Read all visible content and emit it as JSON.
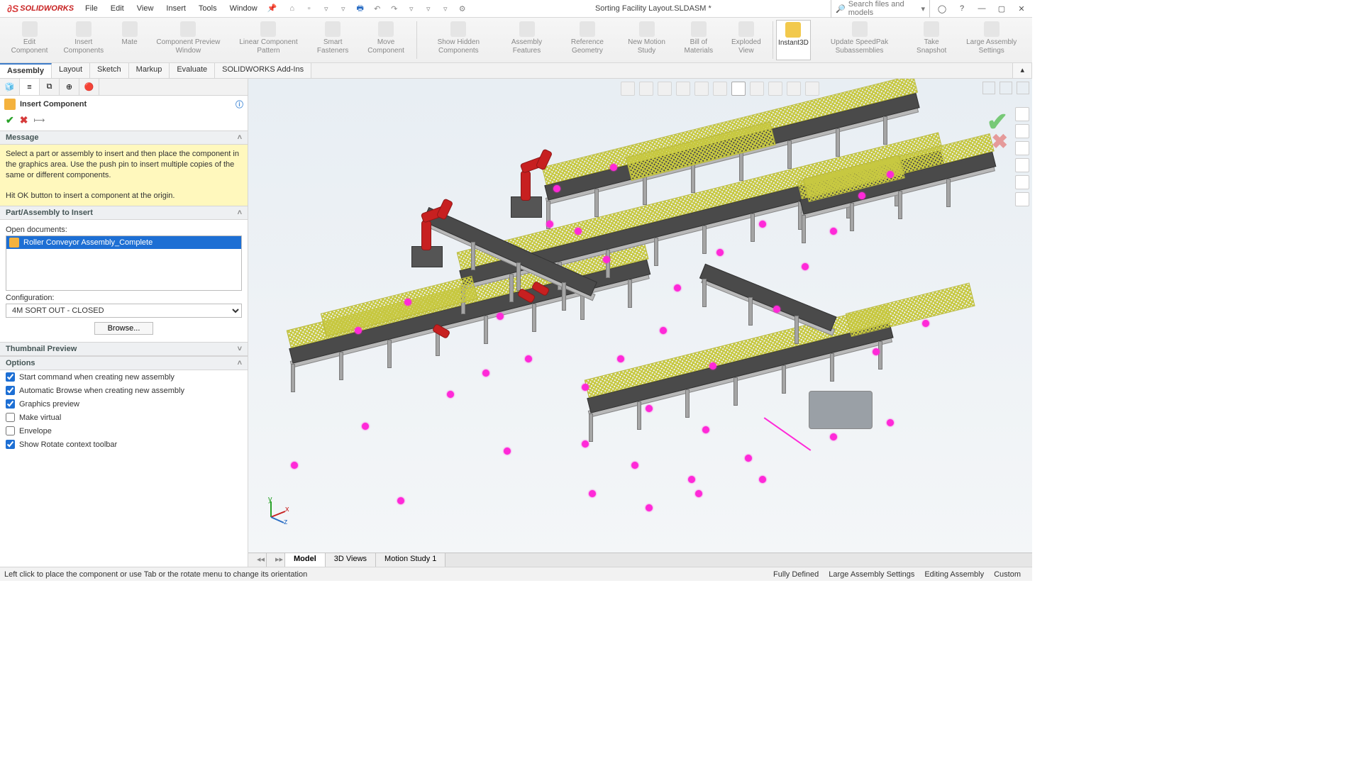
{
  "app": {
    "brand": "SOLIDWORKS",
    "doc_title": "Sorting Facility Layout.SLDASM *",
    "search_placeholder": "Search files and models"
  },
  "menu": {
    "items": [
      "File",
      "Edit",
      "View",
      "Insert",
      "Tools",
      "Window"
    ]
  },
  "ribbon": {
    "buttons": [
      {
        "label": "Edit Component"
      },
      {
        "label": "Insert Components"
      },
      {
        "label": "Mate"
      },
      {
        "label": "Component Preview Window"
      },
      {
        "label": "Linear Component Pattern"
      },
      {
        "label": "Smart Fasteners"
      },
      {
        "label": "Move Component"
      },
      {
        "label": "Show Hidden Components",
        "sep": true
      },
      {
        "label": "Assembly Features"
      },
      {
        "label": "Reference Geometry"
      },
      {
        "label": "New Motion Study"
      },
      {
        "label": "Bill of Materials"
      },
      {
        "label": "Exploded View"
      },
      {
        "label": "Instant3D",
        "active": true,
        "sep": true
      },
      {
        "label": "Update SpeedPak Subassemblies"
      },
      {
        "label": "Take Snapshot"
      },
      {
        "label": "Large Assembly Settings"
      }
    ]
  },
  "ribbon_tabs": [
    "Assembly",
    "Layout",
    "Sketch",
    "Markup",
    "Evaluate",
    "SOLIDWORKS Add-Ins"
  ],
  "pm": {
    "title": "Insert Component",
    "section_message": "Message",
    "message": "Select a part or assembly to insert and then place the component in the graphics area. Use the push pin to insert multiple copies of the same or different components.",
    "message2": "Hit OK button to insert a component at the origin.",
    "section_part": "Part/Assembly to Insert",
    "open_docs_label": "Open documents:",
    "open_doc_item": "Roller Conveyor Assembly_Complete",
    "config_label": "Configuration:",
    "config_value": "4M SORT OUT - CLOSED",
    "browse": "Browse...",
    "section_thumb": "Thumbnail Preview",
    "section_options": "Options",
    "opts": [
      {
        "label": "Start command when creating new assembly",
        "checked": true
      },
      {
        "label": "Automatic Browse when creating new assembly",
        "checked": true
      },
      {
        "label": "Graphics preview",
        "checked": true
      },
      {
        "label": "Make virtual",
        "checked": false
      },
      {
        "label": "Envelope",
        "checked": false
      },
      {
        "label": "Show Rotate context toolbar",
        "checked": true
      }
    ]
  },
  "bottom_tabs": [
    "Model",
    "3D Views",
    "Motion Study 1"
  ],
  "status": {
    "left": "Left click to place the component or use Tab or the rotate menu to change its orientation",
    "right": [
      "Fully Defined",
      "Large Assembly Settings",
      "Editing Assembly",
      "Custom"
    ]
  }
}
